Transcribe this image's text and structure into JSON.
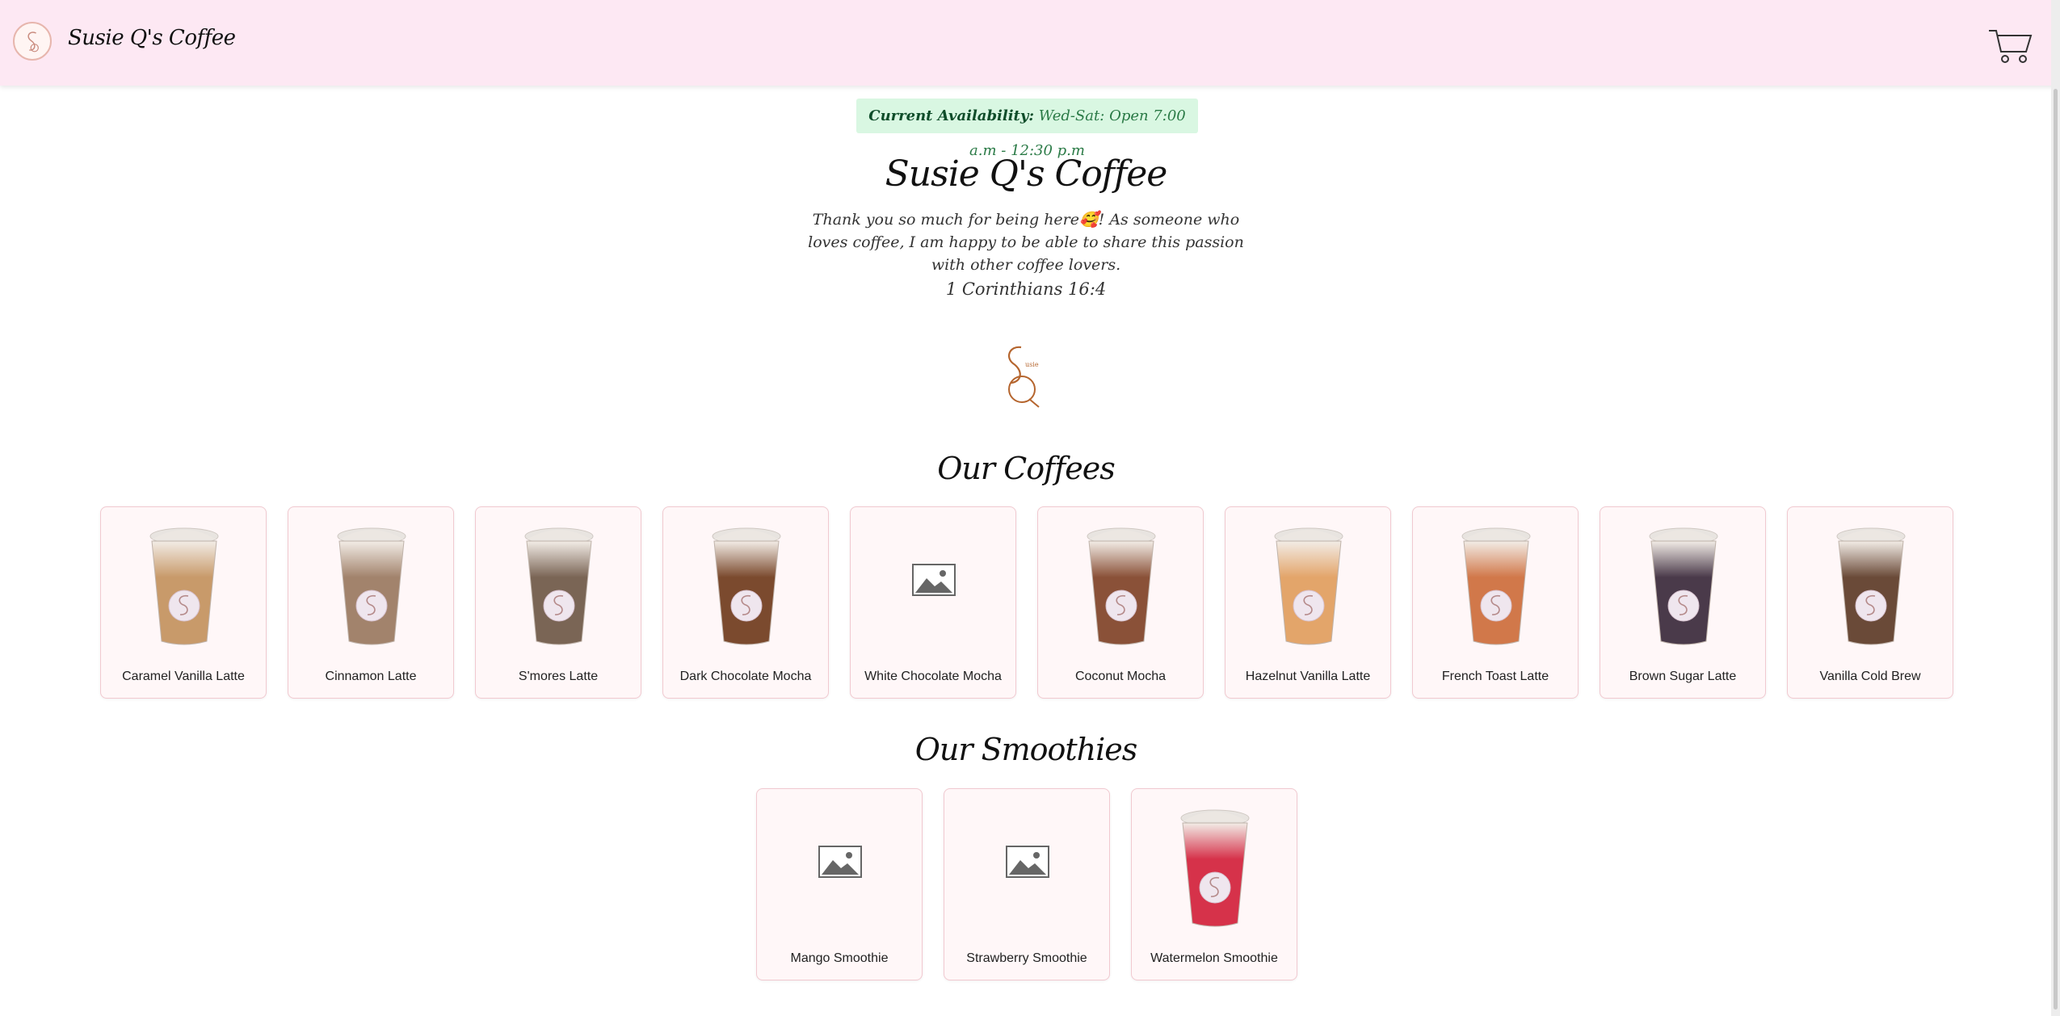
{
  "nav": {
    "brand": "Susie Q's Coffee",
    "logo_icon": "susie-q-logo-icon",
    "cart_icon": "shopping-cart-icon"
  },
  "availability": {
    "label": "Current Availability:",
    "text": " Wed-Sat: Open 7:00 a.m - 12:30 p.m"
  },
  "hero": {
    "title": "Susie Q's Coffee",
    "text": "Thank you so much for being here🥰! As someone who loves coffee, I am happy to be able to share this passion with other coffee lovers.",
    "verse": "1 Corinthians 16:4"
  },
  "sections": {
    "coffees_title": "Our Coffees",
    "smoothies_title": "Our Smoothies"
  },
  "coffees": [
    {
      "name": "Caramel Vanilla Latte",
      "image": "caramel-vanilla-latte-photo",
      "color": "#c89a6a"
    },
    {
      "name": "Cinnamon Latte",
      "image": "cinnamon-latte-photo",
      "color": "#a2836c"
    },
    {
      "name": "S'mores Latte",
      "image": "smores-latte-photo",
      "color": "#7a6555"
    },
    {
      "name": "Dark Chocolate Mocha",
      "image": "dark-chocolate-mocha-photo",
      "color": "#7b4a2e"
    },
    {
      "name": "White Chocolate Mocha",
      "image": "image-placeholder-icon",
      "color": null
    },
    {
      "name": "Coconut Mocha",
      "image": "coconut-mocha-photo",
      "color": "#8a5138"
    },
    {
      "name": "Hazelnut Vanilla Latte",
      "image": "hazelnut-vanilla-latte-photo",
      "color": "#e3a56a"
    },
    {
      "name": "French Toast Latte",
      "image": "french-toast-latte-photo",
      "color": "#d1784a"
    },
    {
      "name": "Brown Sugar Latte",
      "image": "brown-sugar-latte-photo",
      "color": "#4a3a4a"
    },
    {
      "name": "Vanilla Cold Brew",
      "image": "vanilla-cold-brew-photo",
      "color": "#6a4a38"
    }
  ],
  "smoothies": [
    {
      "name": "Mango Smoothie",
      "image": "image-placeholder-icon",
      "color": null
    },
    {
      "name": "Strawberry Smoothie",
      "image": "image-placeholder-icon",
      "color": null
    },
    {
      "name": "Watermelon Smoothie",
      "image": "watermelon-smoothie-photo",
      "color": "#d6324a"
    }
  ],
  "colors": {
    "navbar_bg": "#fde8f3",
    "availability_bg": "#d9f7e2",
    "card_bg": "#fff7f8",
    "card_border": "#f1c9d0",
    "logo_brown": "#b5652e"
  }
}
